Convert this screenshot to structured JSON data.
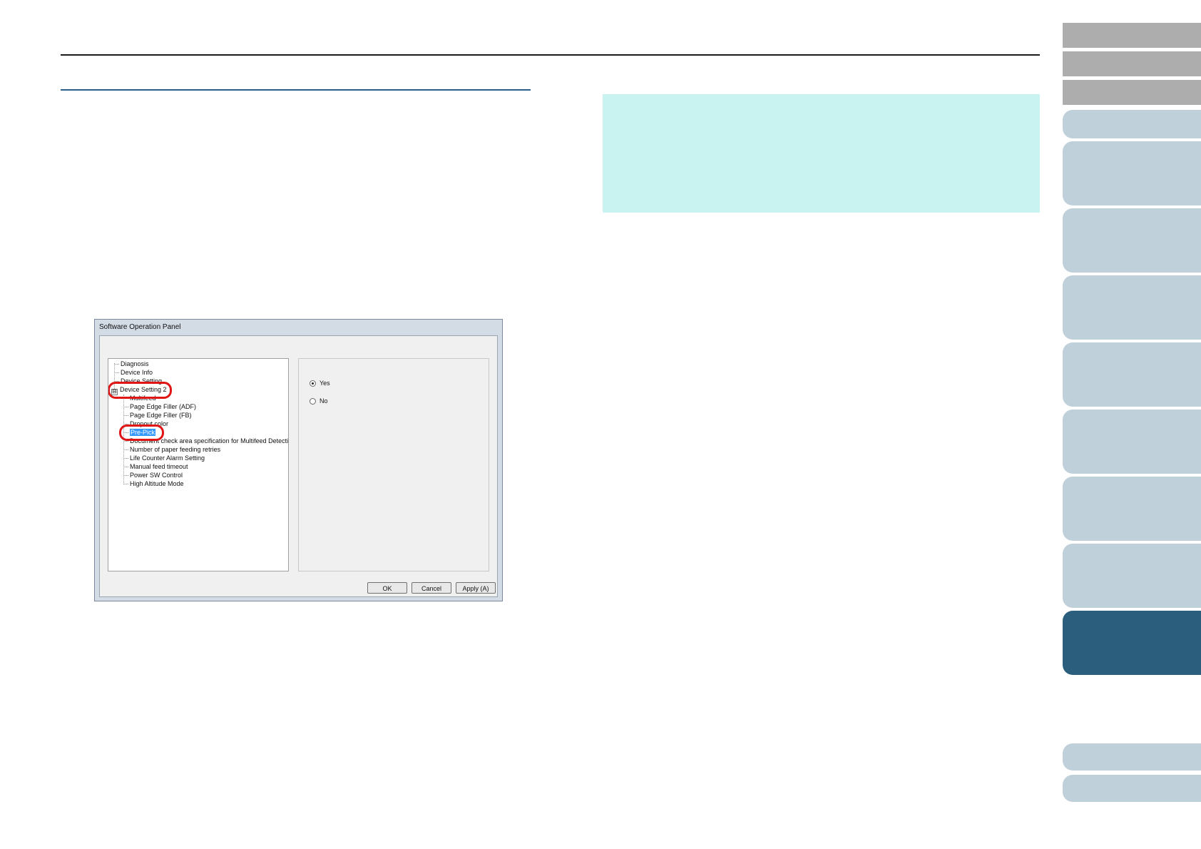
{
  "dialog": {
    "title": "Software Operation Panel",
    "tree": [
      {
        "label": "Diagnosis"
      },
      {
        "label": "Device Info"
      },
      {
        "label": "Device Setting"
      },
      {
        "label": "Device Setting 2"
      },
      {
        "label": "Multifeed"
      },
      {
        "label": "Page Edge Filler (ADF)"
      },
      {
        "label": "Page Edge Filler (FB)"
      },
      {
        "label": "Dropout color"
      },
      {
        "label": "Pre-Pick"
      },
      {
        "label": "Document check area specification for Multifeed Detection"
      },
      {
        "label": "Number of paper feeding retries"
      },
      {
        "label": "Life Counter Alarm Setting"
      },
      {
        "label": "Manual feed timeout"
      },
      {
        "label": "Power SW Control"
      },
      {
        "label": "High Altitude Mode"
      }
    ],
    "expander_symbol": "⊟",
    "options": {
      "yes": "Yes",
      "no": "No",
      "selected": "Yes"
    },
    "buttons": {
      "ok": "OK",
      "cancel": "Cancel",
      "apply": "Apply (A)"
    }
  },
  "colors": {
    "hint_box": "#c8f3f1",
    "tab_dark": "#2b5e7c",
    "tab_light": "#c0d0da",
    "tab_gray": "#adadad",
    "highlight": "#e01515"
  }
}
